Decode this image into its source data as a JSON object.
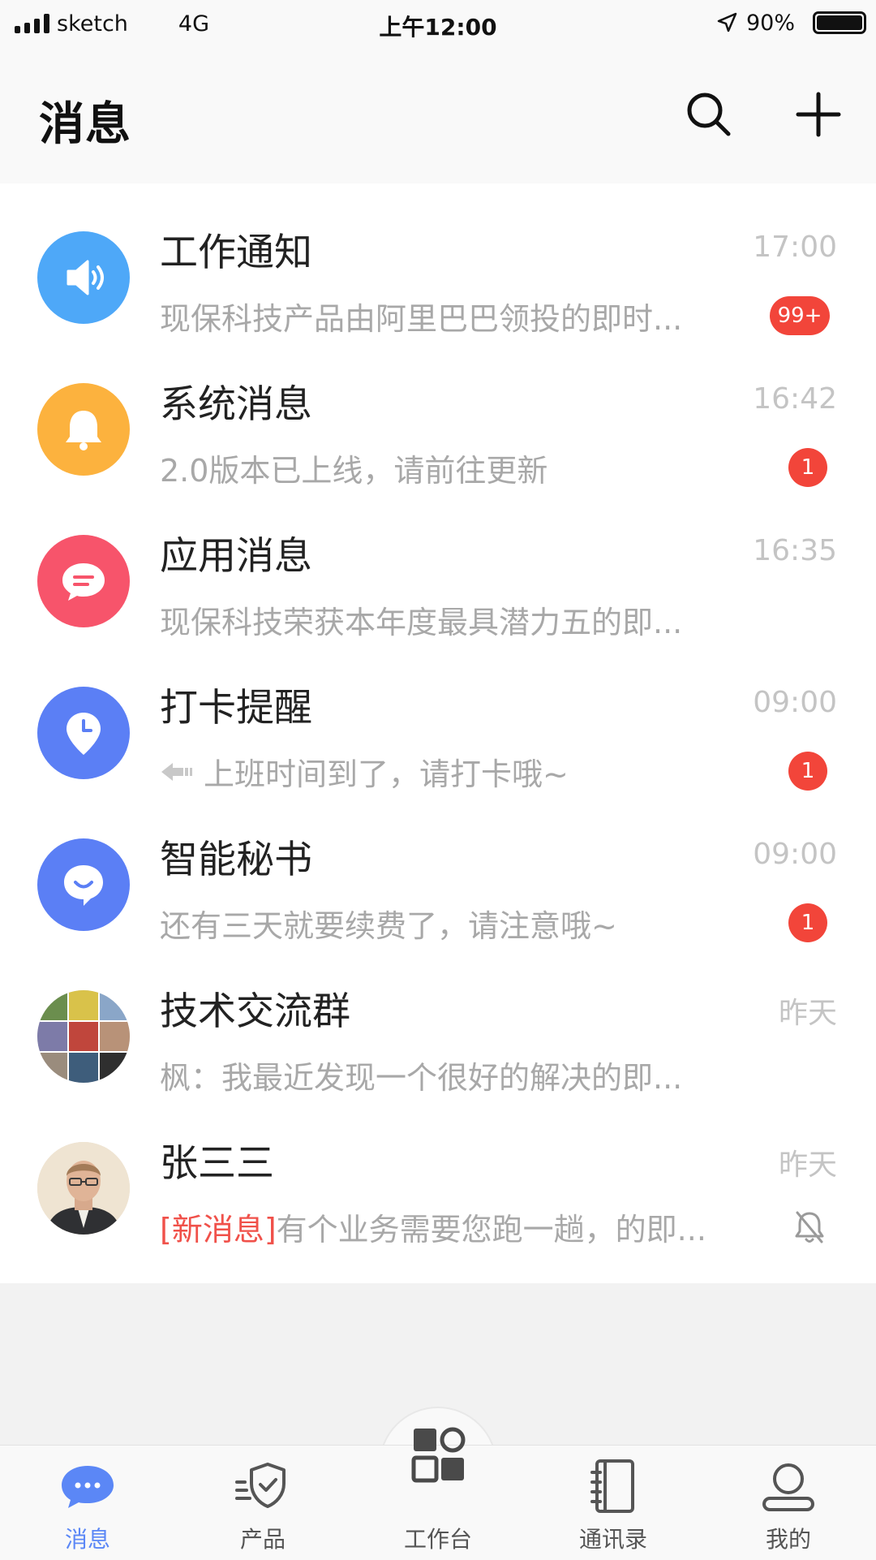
{
  "status_bar": {
    "carrier": "sketch",
    "network": "4G",
    "time": "上午12:00",
    "battery": "90%"
  },
  "header": {
    "title": "消息",
    "search_icon": "search-icon",
    "add_icon": "plus-icon"
  },
  "messages": [
    {
      "title": "工作通知",
      "time": "17:00",
      "preview": "现保科技产品由阿里巴巴领投的即时...",
      "badge": "99+",
      "icon": "speaker-icon",
      "color": "#4ea8f8"
    },
    {
      "title": "系统消息",
      "time": "16:42",
      "preview": "2.0版本已上线，请前往更新",
      "badge": "1",
      "icon": "bell-icon",
      "color": "#fcb23e"
    },
    {
      "title": "应用消息",
      "time": "16:35",
      "preview": "现保科技荣获本年度最具潜力五的即...",
      "badge": "",
      "icon": "chat-bubble-icon",
      "color": "#f7546b"
    },
    {
      "title": "打卡提醒",
      "time": "09:00",
      "preview": "上班时间到了，请打卡哦~",
      "badge": "1",
      "icon": "location-clock-icon",
      "color": "#5b7ff5",
      "preview_icon": "arrow-left-icon"
    },
    {
      "title": "智能秘书",
      "time": "09:00",
      "preview": "还有三天就要续费了，请注意哦~",
      "badge": "1",
      "icon": "smile-bubble-icon",
      "color": "#5b7ff5"
    },
    {
      "title": "技术交流群",
      "time": "昨天",
      "preview": "枫：我最近发现一个很好的解决的即...",
      "badge": "",
      "icon": "group-avatar"
    },
    {
      "title": "张三三",
      "time": "昨天",
      "preview_tag": "[新消息]",
      "preview": "有个业务需要您跑一趟，的即...",
      "badge": "",
      "icon": "user-avatar",
      "muted_icon": "bell-off-icon"
    }
  ],
  "tabbar": [
    {
      "label": "消息",
      "icon": "message-icon",
      "active": true
    },
    {
      "label": "产品",
      "icon": "shield-check-icon",
      "active": false
    },
    {
      "label": "工作台",
      "icon": "workbench-grid-icon",
      "active": false
    },
    {
      "label": "通讯录",
      "icon": "contacts-book-icon",
      "active": false
    },
    {
      "label": "我的",
      "icon": "user-icon",
      "active": false
    }
  ],
  "colors": {
    "accent": "#5b87f6",
    "badge": "#f2453a",
    "tag": "#f0514a"
  }
}
